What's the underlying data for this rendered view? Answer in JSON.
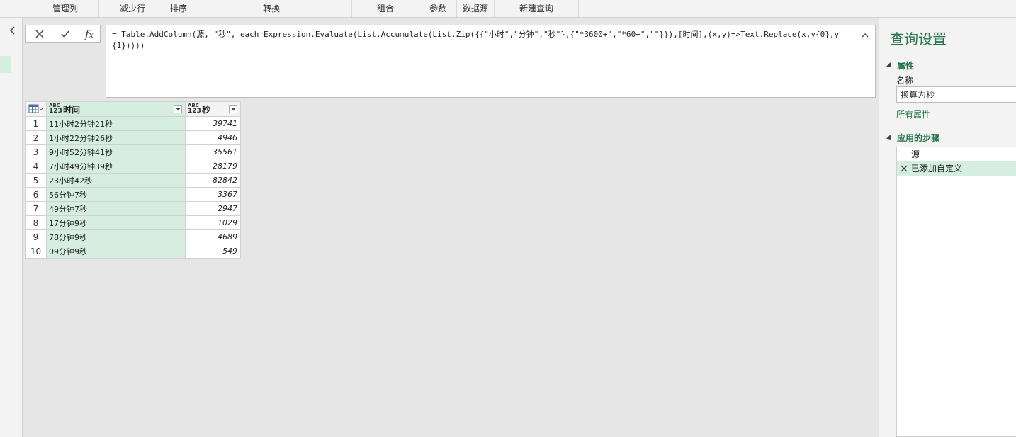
{
  "ribbon": {
    "groups": [
      "管理列",
      "减少行",
      "排序",
      "转换",
      "组合",
      "参数",
      "数据源",
      "新建查询"
    ]
  },
  "formula": {
    "text": "= Table.AddColumn(源, \"秒\", each Expression.Evaluate(List.Accumulate(List.Zip({{\"小时\",\"分钟\",\"秒\"},{\"*3600+\",\"*60+\",\"\"}}),[时间],(x,y)=>Text.Replace(x,y{0},y{1}))))"
  },
  "table": {
    "columns": [
      {
        "type_top": "ABC",
        "type_bottom": "123",
        "name": "时间"
      },
      {
        "type_top": "ABC",
        "type_bottom": "123",
        "name": "秒"
      }
    ],
    "rows": [
      {
        "n": "1",
        "time": "11小时2分钟21秒",
        "sec": "39741"
      },
      {
        "n": "2",
        "time": "1小时22分钟26秒",
        "sec": "4946"
      },
      {
        "n": "3",
        "time": "9小时52分钟41秒",
        "sec": "35561"
      },
      {
        "n": "4",
        "time": "7小时49分钟39秒",
        "sec": "28179"
      },
      {
        "n": "5",
        "time": "23小时42秒",
        "sec": "82842"
      },
      {
        "n": "6",
        "time": "56分钟7秒",
        "sec": "3367"
      },
      {
        "n": "7",
        "time": "49分钟7秒",
        "sec": "2947"
      },
      {
        "n": "8",
        "time": "17分钟9秒",
        "sec": "1029"
      },
      {
        "n": "9",
        "time": "78分钟9秒",
        "sec": "4689"
      },
      {
        "n": "10",
        "time": "09分钟9秒",
        "sec": "549"
      }
    ]
  },
  "query_settings": {
    "title": "查询设置",
    "properties_header": "属性",
    "name_label": "名称",
    "name_value": "换算为秒",
    "all_properties": "所有属性",
    "steps_header": "应用的步骤",
    "steps": [
      "源",
      "已添加自定义"
    ]
  },
  "colors": {
    "accent": "#217346",
    "selected_fill": "#d6eedf"
  }
}
